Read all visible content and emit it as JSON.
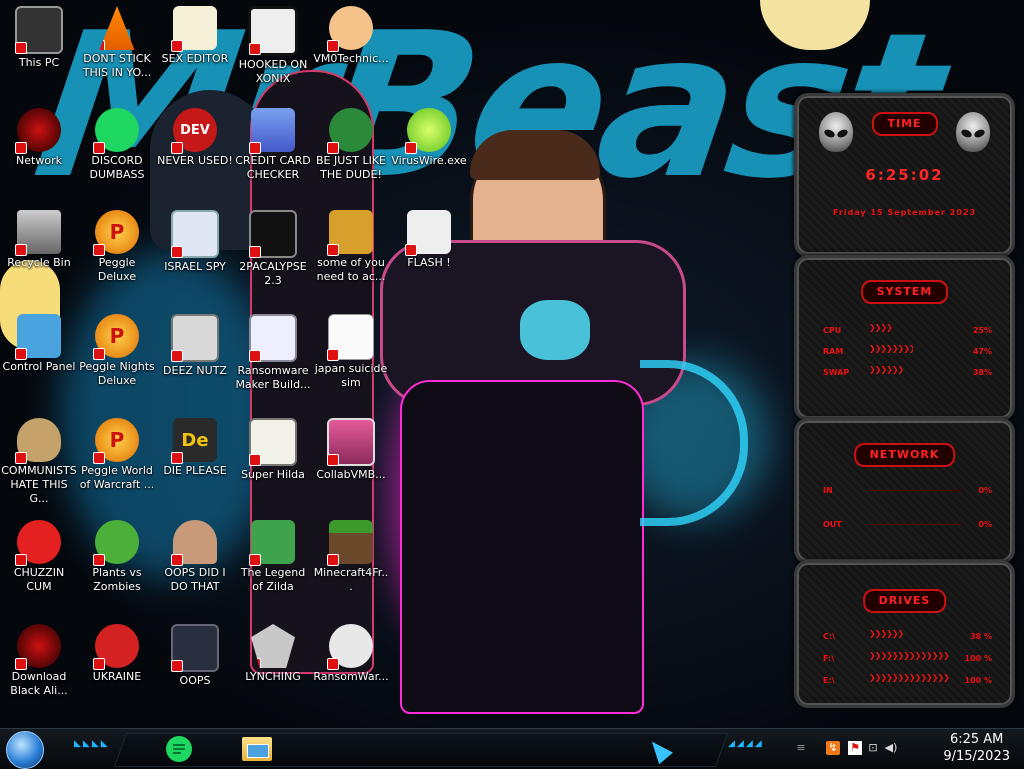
{
  "wallpaper": {
    "title_art": "MrBeast"
  },
  "desktop_icons": [
    {
      "id": "this-pc",
      "label": "This PC",
      "icon": "computer-icon"
    },
    {
      "id": "dont-stick",
      "label": "DONT STICK THIS IN YO...",
      "icon": "traffic-cone-icon"
    },
    {
      "id": "sex-editor",
      "label": "SEX EDITOR",
      "icon": "hex-editor-icon"
    },
    {
      "id": "hooked-on-xonix",
      "label": "HOOKED ON XONIX",
      "icon": "xonix-game-icon"
    },
    {
      "id": "vm0-technic",
      "label": "VM0Technic...",
      "icon": "doctor-icon"
    },
    {
      "id": "network",
      "label": "Network",
      "icon": "alien-network-icon"
    },
    {
      "id": "discord",
      "label": "DISCORD DUMBASS",
      "icon": "chat-icon"
    },
    {
      "id": "never-used",
      "label": "NEVER USED!",
      "icon": "dev-cpp-icon",
      "badge": "DEV"
    },
    {
      "id": "credit-card",
      "label": "CREDIT CARD CHECKER",
      "icon": "credit-card-icon"
    },
    {
      "id": "be-just-like",
      "label": "BE JUST LIKE THE DUDE!",
      "icon": "santa-icon"
    },
    {
      "id": "viruswire",
      "label": "VirusWire.exe",
      "icon": "lime-icon"
    },
    {
      "id": "recycle-bin",
      "label": "Recycle Bin",
      "icon": "trash-icon"
    },
    {
      "id": "peggle-deluxe",
      "label": "Peggle Deluxe",
      "icon": "peggle-icon",
      "badge": "P"
    },
    {
      "id": "israel-spy",
      "label": "ISRAEL SPY",
      "icon": "remote-desktop-icon"
    },
    {
      "id": "2pacalypse",
      "label": "2PACALYPSE 2.3",
      "icon": "terminal-icon"
    },
    {
      "id": "some-of-you",
      "label": "some of you need to ac...",
      "icon": "beaver-icon"
    },
    {
      "id": "flash",
      "label": "FLASH !",
      "icon": "flash-icon"
    },
    {
      "id": "control-panel",
      "label": "Control Panel",
      "icon": "control-panel-icon"
    },
    {
      "id": "peggle-nights",
      "label": "Peggle Nights Deluxe",
      "icon": "peggle-icon",
      "badge": "P"
    },
    {
      "id": "deez-nutz",
      "label": "DEEZ NUTZ",
      "icon": "windows-stack-icon"
    },
    {
      "id": "ransomware-maker",
      "label": "Ransomware Maker Build...",
      "icon": "window-app-icon"
    },
    {
      "id": "japan-suicide",
      "label": "japan suicide sim",
      "icon": "document-icon"
    },
    {
      "id": "communists",
      "label": "COMMUNISTS HATE THIS G...",
      "icon": "money-bag-icon"
    },
    {
      "id": "peggle-world",
      "label": "Peggle World of Warcraft ...",
      "icon": "peggle-icon",
      "badge": "P"
    },
    {
      "id": "die-please",
      "label": "DIE PLEASE",
      "icon": "adobe-director-icon",
      "badge": "De"
    },
    {
      "id": "super-hilda",
      "label": "Super Hilda",
      "icon": "pixel-cat-icon"
    },
    {
      "id": "collabvmb",
      "label": "CollabVMB...",
      "icon": "monitor-icon"
    },
    {
      "id": "chuzzin-cum",
      "label": "CHUZZIN CUM",
      "icon": "chuzzle-icon"
    },
    {
      "id": "pvz",
      "label": "Plants vs Zombies",
      "icon": "plant-icon"
    },
    {
      "id": "oops-did",
      "label": "OOPS DID I DO THAT",
      "icon": "portrait-icon"
    },
    {
      "id": "legend-zilda",
      "label": "The Legend of Zilda",
      "icon": "pixel-hero-icon"
    },
    {
      "id": "minecraft",
      "label": "Minecraft4Fr...",
      "icon": "grass-block-icon"
    },
    {
      "id": "download-alien",
      "label": "Download Black Ali...",
      "icon": "alien-icon"
    },
    {
      "id": "ukraine",
      "label": "UKRAINE",
      "icon": "radiation-icon"
    },
    {
      "id": "oops",
      "label": "OOPS",
      "icon": "disk-app-icon"
    },
    {
      "id": "lynching",
      "label": "LYNCHING",
      "icon": "shield-flag-icon"
    },
    {
      "id": "ransomwar",
      "label": "RansomWar...",
      "icon": "skull-icon"
    }
  ],
  "gadgets": {
    "time": {
      "title": "TIME",
      "clock": "6:25:02",
      "date": "Friday 15 September 2023"
    },
    "system": {
      "title": "SYSTEM",
      "rows": [
        {
          "name": "CPU",
          "value": "25%",
          "level": 0.25
        },
        {
          "name": "RAM",
          "value": "47%",
          "level": 0.47
        },
        {
          "name": "SWAP",
          "value": "38%",
          "level": 0.38
        }
      ]
    },
    "network": {
      "title": "NETWORK",
      "rows": [
        {
          "name": "IN",
          "value": "0%",
          "level": 0
        },
        {
          "name": "OUT",
          "value": "0%",
          "level": 0
        }
      ]
    },
    "drives": {
      "title": "DRIVES",
      "rows": [
        {
          "name": "C:\\",
          "value": "38 %",
          "level": 0.38
        },
        {
          "name": "F:\\",
          "value": "100 %",
          "level": 1
        },
        {
          "name": "E:\\",
          "value": "100 %",
          "level": 1
        }
      ]
    }
  },
  "taskbar": {
    "pinned": [
      {
        "id": "chat-app",
        "icon": "chat-icon"
      },
      {
        "id": "file-explorer",
        "icon": "folder-icon"
      }
    ],
    "clock_time": "6:25 AM",
    "clock_date": "9/15/2023",
    "colors": {
      "accent": "#1fb6ff",
      "alert": "#e11111"
    }
  }
}
